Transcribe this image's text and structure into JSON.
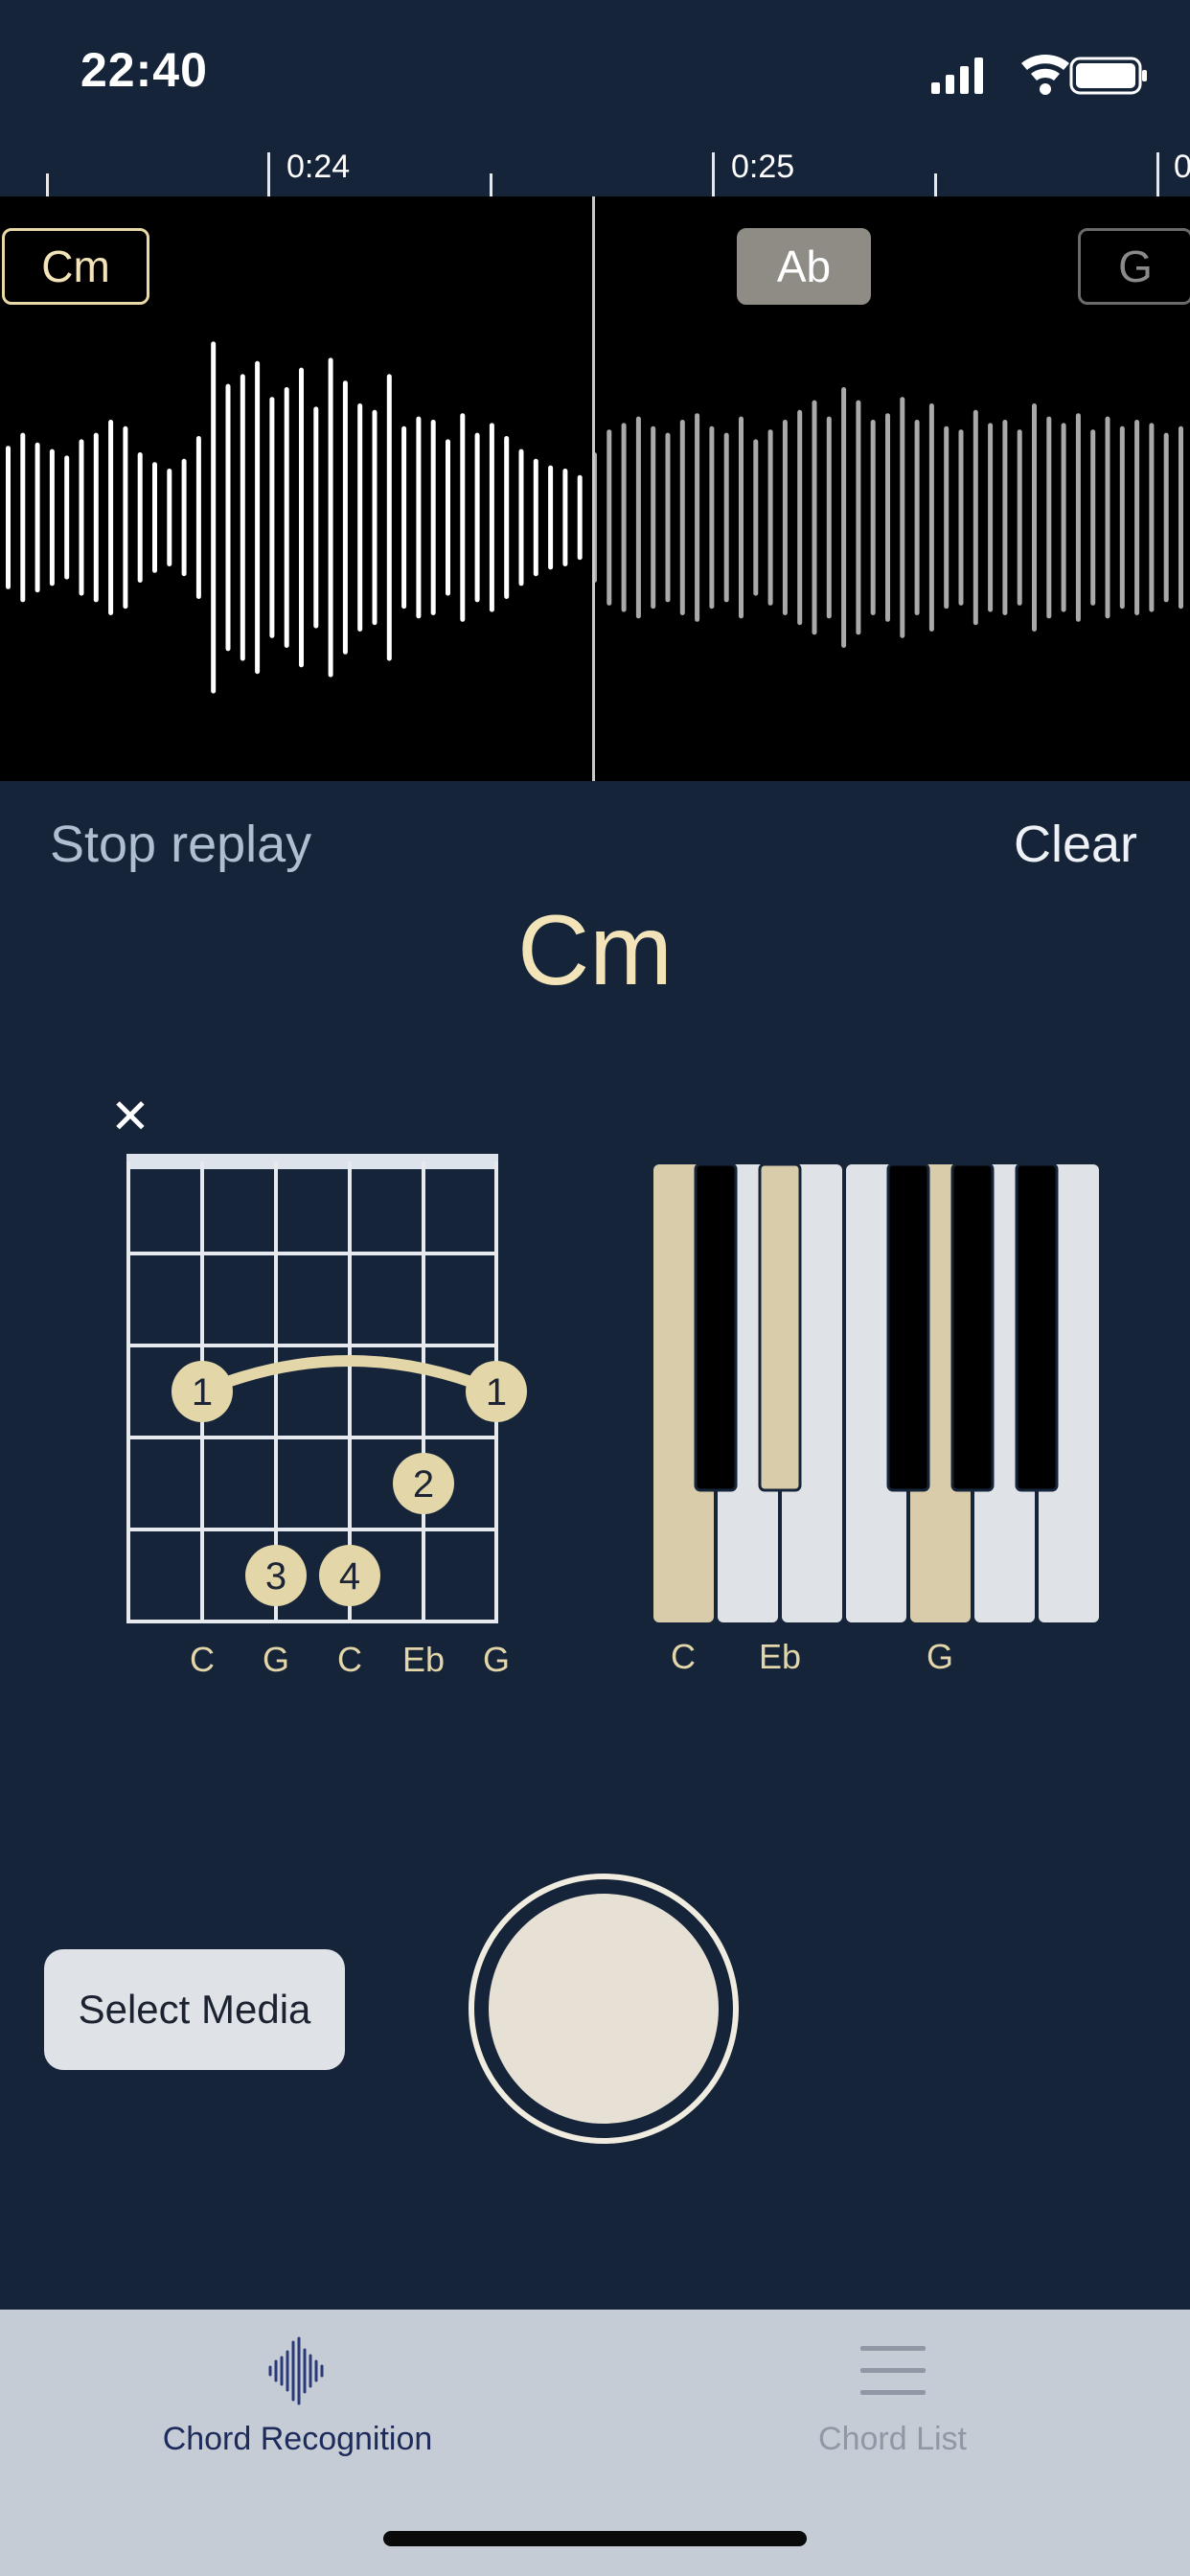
{
  "status_bar": {
    "time": "22:40",
    "icons": [
      "cellular-signal-icon",
      "wifi-icon",
      "battery-icon"
    ]
  },
  "timeline": {
    "labels": [
      "0:24",
      "0:25",
      "0"
    ]
  },
  "waveform": {
    "chords": [
      {
        "label": "Cm",
        "state": "current"
      },
      {
        "label": "Ab",
        "state": "upcoming-selected"
      },
      {
        "label": "G",
        "state": "upcoming"
      }
    ]
  },
  "controls": {
    "stop_replay": "Stop replay",
    "clear": "Clear"
  },
  "current_chord": "Cm",
  "guitar": {
    "muted_string_marker": "✕",
    "string_notes": [
      "C",
      "G",
      "C",
      "Eb",
      "G"
    ],
    "finger_labels": [
      "1",
      "1",
      "2",
      "3",
      "4"
    ]
  },
  "piano": {
    "notes": [
      "C",
      "Eb",
      "G"
    ]
  },
  "bottom": {
    "select_media": "Select Media"
  },
  "tabs": [
    {
      "label": "Chord Recognition",
      "icon": "waveform-icon",
      "active": true
    },
    {
      "label": "Chord List",
      "icon": "list-icon",
      "active": false
    }
  ],
  "colors": {
    "background": "#16243a",
    "accent_cream": "#f2e4b8",
    "chord_dot": "#e3d6a9",
    "tab_active": "#1d2a5c",
    "tab_inactive": "#9098a6"
  }
}
